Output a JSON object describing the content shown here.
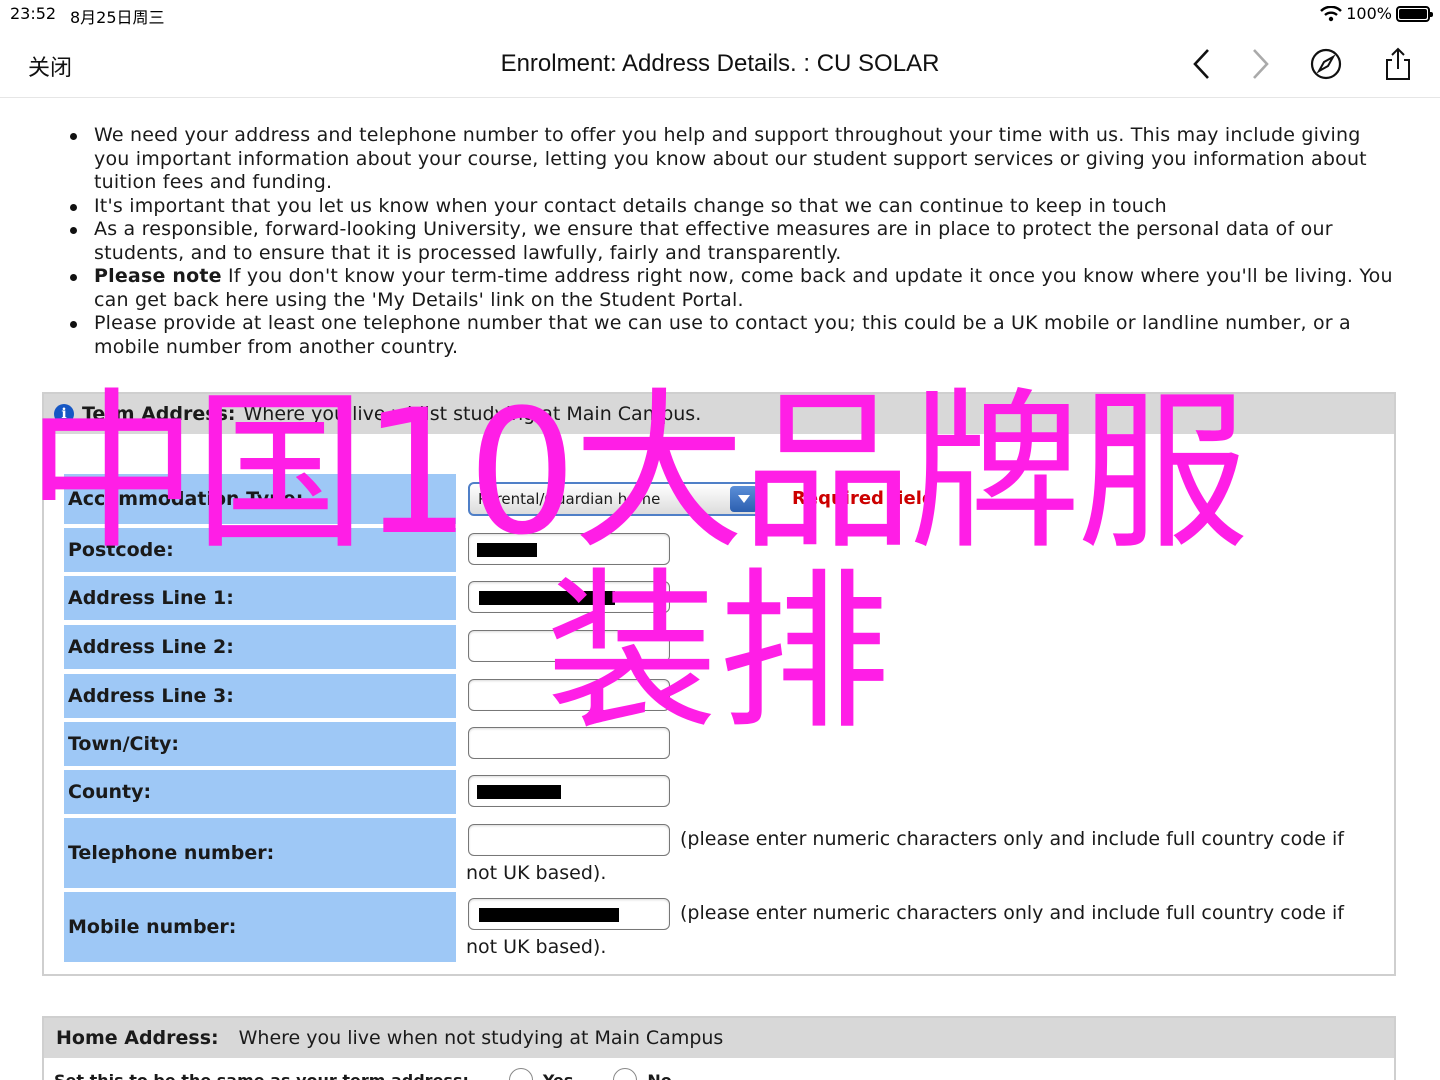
{
  "status_bar": {
    "time": "23:52",
    "date": "8月25日周三",
    "battery": "100%"
  },
  "nav": {
    "close_label": "关闭",
    "title": "Enrolment: Address Details. : CU SOLAR"
  },
  "bullets": [
    {
      "bold": "",
      "text": "We need your address and telephone number to offer you help and support throughout your time with us. This may include giving you important information about your course, letting you know about our student support services or giving you information about tuition fees and funding."
    },
    {
      "bold": "",
      "text": "It's important that you let us know when your contact details change so that we can continue to keep in touch"
    },
    {
      "bold": "",
      "text": "As a responsible, forward-looking University, we ensure that effective measures are in place to protect the personal data of our students, and to ensure that it is processed lawfully, fairly and transparently."
    },
    {
      "bold": "Please note",
      "text": " If you don't know your term-time address right now, come back and update it once you know where you'll be living. You can get back here using the 'My Details' link on the Student Portal."
    },
    {
      "bold": "",
      "text": "Please provide at least one telephone number that we can use to contact you; this could be a UK mobile or landline number, or a mobile number from another country."
    }
  ],
  "term_address": {
    "heading_bold": "Term Address:",
    "heading_text": "Where you live whilst studying at Main Campus.",
    "accommodation_label": "Accommodation Type:",
    "accommodation_value": "Parental/Guardian home",
    "required_text": "Required field",
    "postcode_label": "Postcode:",
    "address1_label": "Address Line 1:",
    "address2_label": "Address Line 2:",
    "address3_label": "Address Line 3:",
    "town_label": "Town/City:",
    "county_label": "County:",
    "telephone_label": "Telephone number:",
    "mobile_label": "Mobile number:",
    "numeric_hint": "(please enter numeric characters only and include full country code if not UK based)."
  },
  "home_address": {
    "heading_bold": "Home Address:",
    "heading_text": "Where you live when not studying at Main Campus",
    "same_label": "Set this to be the same as your term address:",
    "yes_label": "Yes",
    "no_label": "No"
  },
  "overlay": {
    "line1": "中国10大品牌服",
    "line2": "装排"
  },
  "colors": {
    "label_bg": "#9ec8f6",
    "header_bg": "#d8d8d8",
    "overlay": "#ff1ee6",
    "required": "#cc0000"
  },
  "icons": [
    "back-chevron-icon",
    "forward-chevron-icon",
    "compass-icon",
    "share-icon",
    "info-icon",
    "wifi-icon",
    "battery-icon",
    "dropdown-arrow-icon"
  ]
}
